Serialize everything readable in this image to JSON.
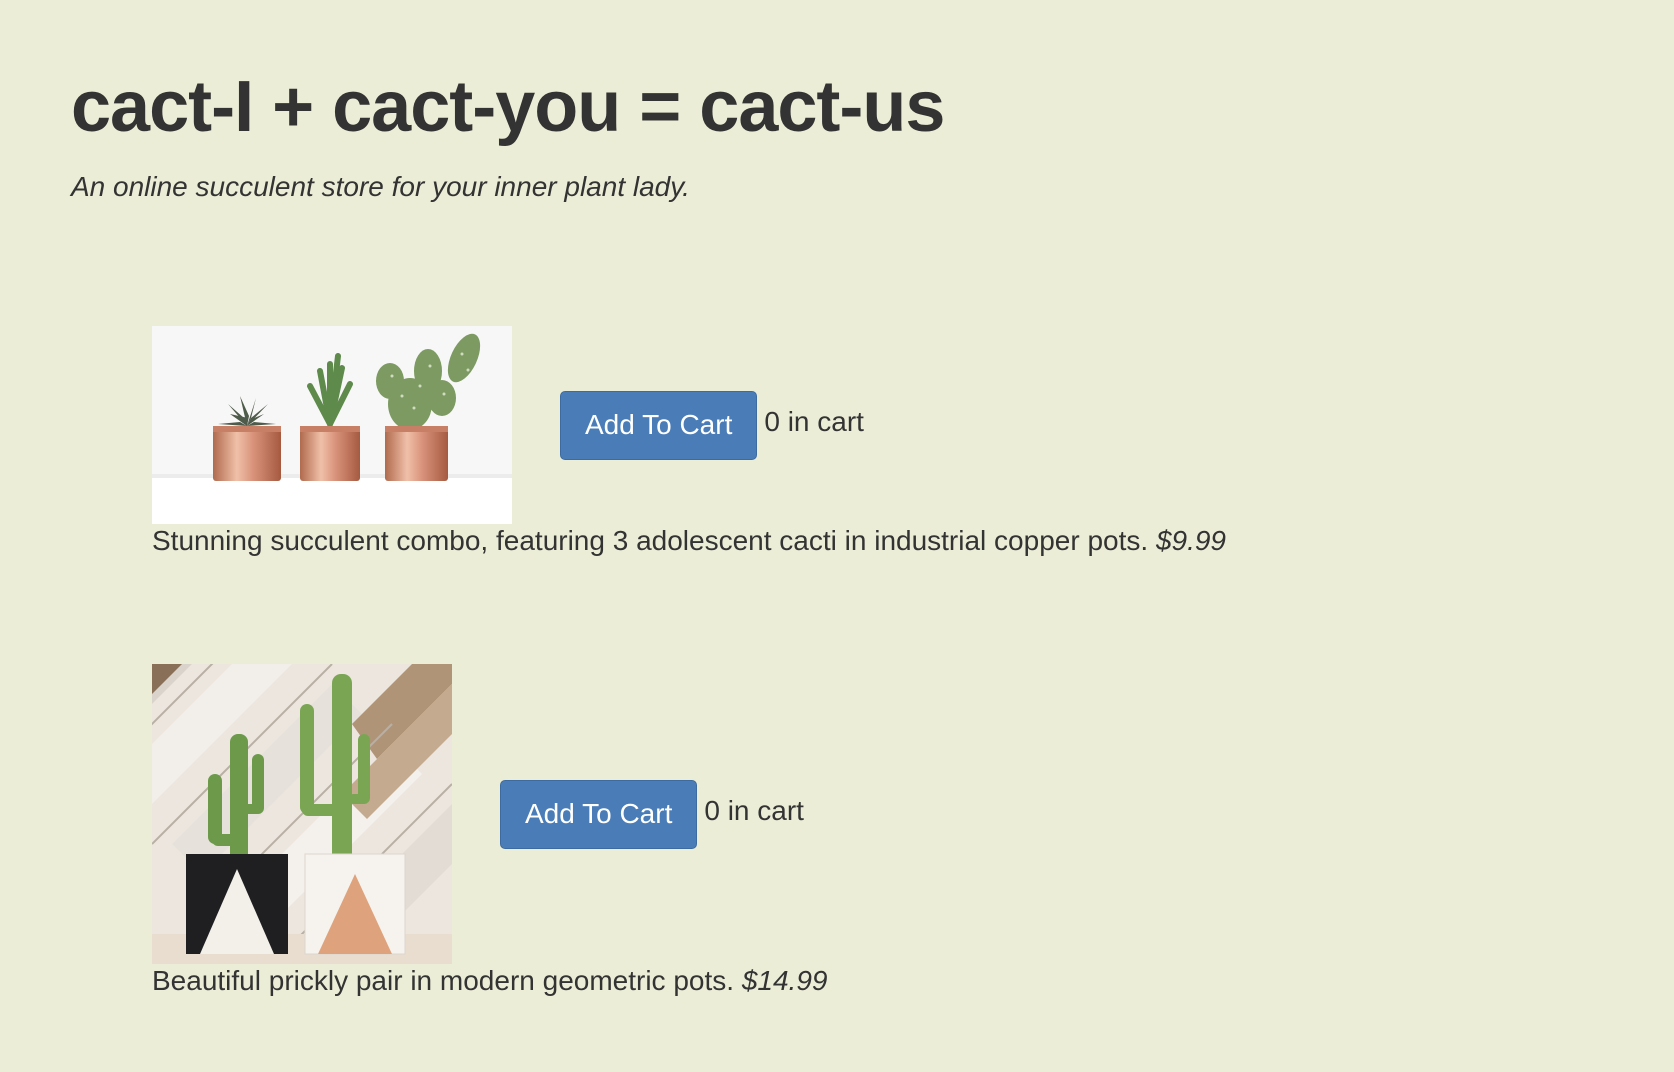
{
  "header": {
    "title": "cact-I + cact-you = cact-us",
    "tagline": "An online succulent store for your inner plant lady."
  },
  "products": [
    {
      "button_label": "Add To Cart",
      "cart_count": "0 in cart",
      "description": "Stunning succulent combo, featuring 3 adolescent cacti in industrial copper pots.",
      "price": "$9.99"
    },
    {
      "button_label": "Add To Cart",
      "cart_count": "0 in cart",
      "description": "Beautiful prickly pair in modern geometric pots.",
      "price": "$14.99"
    }
  ],
  "colors": {
    "background": "#ecedd7",
    "button": "#4a7db8",
    "text": "#333333"
  }
}
